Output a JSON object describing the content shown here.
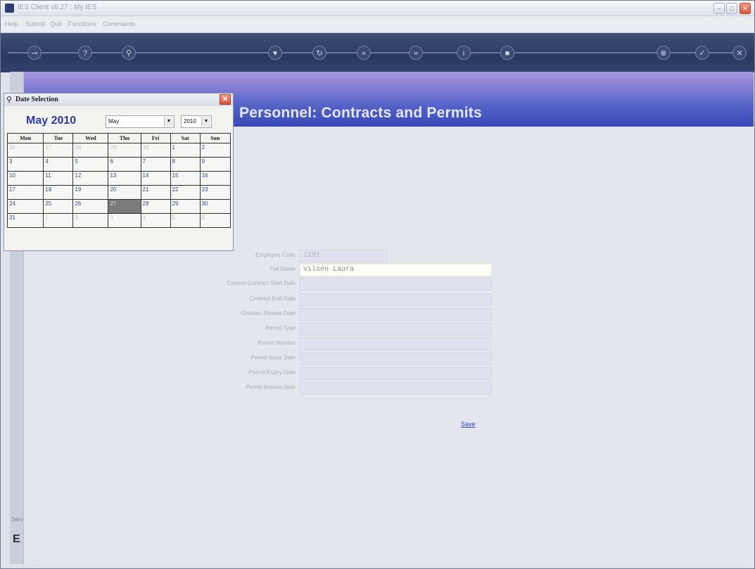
{
  "window": {
    "title": "IES Client v8.27 : My IES",
    "minimize": "–",
    "maximize": "□",
    "close": "✕"
  },
  "menu": [
    "Help",
    "Submit",
    "Quit",
    "Functions",
    "Commands"
  ],
  "toolbar_icons": [
    {
      "name": "key-icon",
      "glyph": "⊸"
    },
    {
      "name": "help-icon",
      "glyph": "?"
    },
    {
      "name": "search-icon",
      "glyph": "⚲"
    },
    {
      "name": "heart-icon",
      "glyph": "♥"
    },
    {
      "name": "refresh-icon",
      "glyph": "↻"
    },
    {
      "name": "first-icon",
      "glyph": "«"
    },
    {
      "name": "last-icon",
      "glyph": "»"
    },
    {
      "name": "info-icon",
      "glyph": "i"
    },
    {
      "name": "bookmark-icon",
      "glyph": "■"
    },
    {
      "name": "cancel-icon",
      "glyph": "⊗"
    },
    {
      "name": "check-icon",
      "glyph": "✓"
    },
    {
      "name": "close-icon",
      "glyph": "✕"
    }
  ],
  "page": {
    "title": "Personnel: Contracts and Permits",
    "save_label": "Save"
  },
  "form": {
    "rows": [
      {
        "label": "Employee Code",
        "value": "1101"
      },
      {
        "label": "Full Name",
        "value": "Vilsen Laura"
      },
      {
        "label": "Current Contract Start Date",
        "value": ""
      },
      {
        "label": "Contract End Date",
        "value": ""
      },
      {
        "label": "Contract Review Date",
        "value": ""
      },
      {
        "label": "Permit Type",
        "value": ""
      },
      {
        "label": "Permit Number",
        "value": ""
      },
      {
        "label": "Permit Issue Date",
        "value": ""
      },
      {
        "label": "Permit Expiry Date",
        "value": ""
      },
      {
        "label": "Permit Review Date",
        "value": ""
      }
    ]
  },
  "date_popup": {
    "title": "Date Selection",
    "month_title": "May 2010",
    "month_select": "May",
    "year_select": "2010",
    "weekdays": [
      "Mon",
      "Tue",
      "Wed",
      "Thu",
      "Fri",
      "Sat",
      "Sun"
    ],
    "weeks": [
      [
        {
          "d": "26",
          "o": true
        },
        {
          "d": "27",
          "o": true
        },
        {
          "d": "28",
          "o": true
        },
        {
          "d": "29",
          "o": true
        },
        {
          "d": "30",
          "o": true
        },
        {
          "d": "1"
        },
        {
          "d": "2"
        }
      ],
      [
        {
          "d": "3"
        },
        {
          "d": "4"
        },
        {
          "d": "5"
        },
        {
          "d": "6"
        },
        {
          "d": "7"
        },
        {
          "d": "8"
        },
        {
          "d": "9"
        }
      ],
      [
        {
          "d": "10"
        },
        {
          "d": "11"
        },
        {
          "d": "12"
        },
        {
          "d": "13"
        },
        {
          "d": "14"
        },
        {
          "d": "15"
        },
        {
          "d": "16"
        }
      ],
      [
        {
          "d": "17"
        },
        {
          "d": "18"
        },
        {
          "d": "19"
        },
        {
          "d": "20"
        },
        {
          "d": "21"
        },
        {
          "d": "22"
        },
        {
          "d": "23"
        }
      ],
      [
        {
          "d": "24"
        },
        {
          "d": "25"
        },
        {
          "d": "26"
        },
        {
          "d": "27",
          "t": true
        },
        {
          "d": "28"
        },
        {
          "d": "29"
        },
        {
          "d": "30"
        }
      ],
      [
        {
          "d": "31"
        },
        {
          "d": "1",
          "o": true
        },
        {
          "d": "2",
          "o": true
        },
        {
          "d": "3",
          "o": true
        },
        {
          "d": "4",
          "o": true
        },
        {
          "d": "5",
          "o": true
        },
        {
          "d": "6",
          "o": true
        }
      ]
    ]
  },
  "sidebar": {
    "bottom_label": "Serv",
    "bottom_glyph": "E"
  }
}
